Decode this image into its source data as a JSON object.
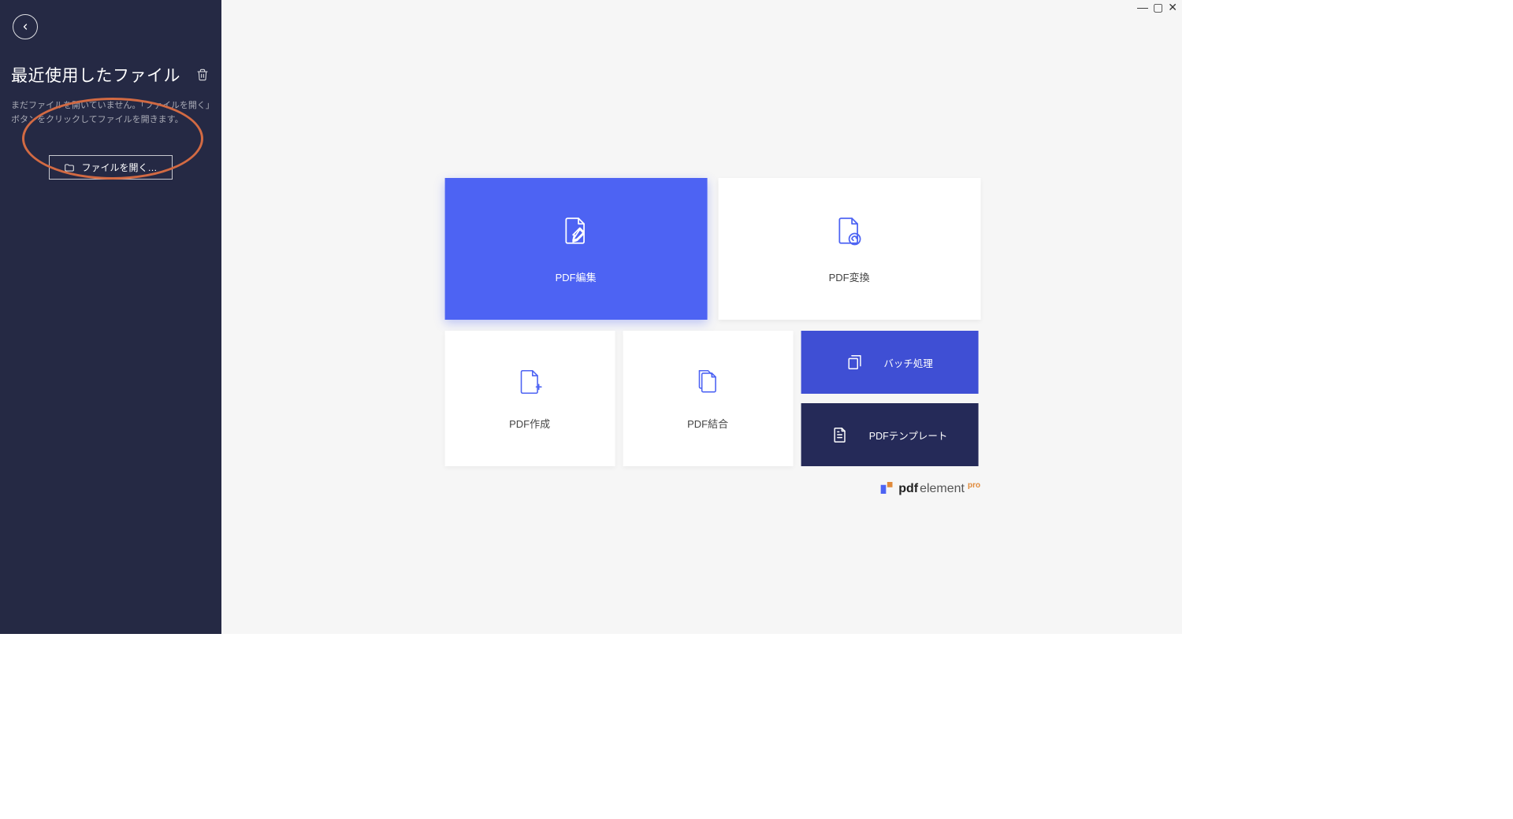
{
  "sidebar": {
    "recent_title": "最近使用したファイル",
    "placeholder": "まだファイルを開いていません。「ファイルを開く」ボタンをクリックしてファイルを開きます。",
    "open_button": "ファイルを開く…"
  },
  "tiles": {
    "edit": "PDF編集",
    "convert": "PDF変換",
    "create": "PDF作成",
    "combine": "PDF結合",
    "batch": "バッチ処理",
    "template": "PDFテンプレート"
  },
  "brand": {
    "pdf": "pdf",
    "element": "element",
    "pro": "pro"
  },
  "window": {
    "min": "—",
    "max": "▢",
    "close": "✕"
  },
  "colors": {
    "sidebar_bg": "#252944",
    "primary": "#4d63f3",
    "highlight": "#d26a43",
    "batch_bg": "#3f4fd4",
    "template_bg": "#252a58"
  }
}
